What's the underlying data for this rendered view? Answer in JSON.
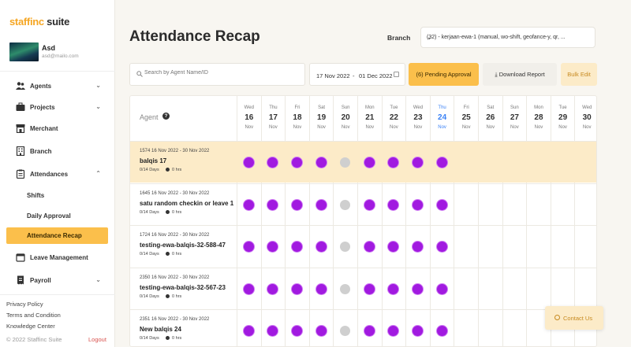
{
  "logo": {
    "brand": "staffinc",
    "suite": "suite"
  },
  "user": {
    "name": "Asd",
    "email": "asd@mailo.com"
  },
  "nav": {
    "agents": "Agents",
    "projects": "Projects",
    "merchant": "Merchant",
    "branch": "Branch",
    "attendances": "Attendances",
    "shifts": "Shifts",
    "daily_approval": "Daily Approval",
    "attendance_recap": "Attendance Recap",
    "leave_management": "Leave Management",
    "payroll": "Payroll"
  },
  "footer": {
    "privacy": "Privacy Policy",
    "terms": "Terms and Condition",
    "knowledge": "Knowledge Center",
    "copyright": "© 2022 Staffinc Suite",
    "logout": "Logout"
  },
  "page": {
    "title": "Attendance Recap",
    "branch_label": "Branch",
    "branch_value": "(32) - kerjaan-ewa-1 (manual, wo-shift, geofance-y, qr, ...",
    "search_placeholder": "Search by Agent Name/ID",
    "date_from": "17 Nov 2022",
    "date_sep": "-",
    "date_to": "01 Dec 2022",
    "pending_button": "(6) Pending Approval",
    "download_button": "Download Report",
    "bulk_button": "Bulk Edit",
    "contact_button": "Contact Us"
  },
  "table": {
    "agent_header": "Agent",
    "help_glyph": "?",
    "days": [
      {
        "dow": "Wed",
        "num": "16",
        "mon": "Nov"
      },
      {
        "dow": "Thu",
        "num": "17",
        "mon": "Nov"
      },
      {
        "dow": "Fri",
        "num": "18",
        "mon": "Nov"
      },
      {
        "dow": "Sat",
        "num": "19",
        "mon": "Nov"
      },
      {
        "dow": "Sun",
        "num": "20",
        "mon": "Nov"
      },
      {
        "dow": "Mon",
        "num": "21",
        "mon": "Nov"
      },
      {
        "dow": "Tue",
        "num": "22",
        "mon": "Nov"
      },
      {
        "dow": "Wed",
        "num": "23",
        "mon": "Nov"
      },
      {
        "dow": "Thu",
        "num": "24",
        "mon": "Nov",
        "today": true
      },
      {
        "dow": "Fri",
        "num": "25",
        "mon": "Nov"
      },
      {
        "dow": "Sat",
        "num": "26",
        "mon": "Nov"
      },
      {
        "dow": "Sun",
        "num": "27",
        "mon": "Nov"
      },
      {
        "dow": "Mon",
        "num": "28",
        "mon": "Nov"
      },
      {
        "dow": "Tue",
        "num": "29",
        "mon": "Nov"
      },
      {
        "dow": "Wed",
        "num": "30",
        "mon": "Nov"
      }
    ],
    "rows": [
      {
        "meta": "1574   16 Nov 2022 - 30 Nov 2022",
        "name": "balqis 17",
        "days": "0/14 Days",
        "hours": "0 hrs",
        "highlight": true,
        "status": [
          "p",
          "p",
          "p",
          "p",
          "g",
          "p",
          "p",
          "p",
          "p"
        ]
      },
      {
        "meta": "1645   16 Nov 2022 - 30 Nov 2022",
        "name": "satu random checkin or leave 1",
        "days": "0/14 Days",
        "hours": "0 hrs",
        "status": [
          "p",
          "p",
          "p",
          "p",
          "g",
          "p",
          "p",
          "p",
          "p"
        ]
      },
      {
        "meta": "1724   16 Nov 2022 - 30 Nov 2022",
        "name": "testing-ewa-balqis-32-588-47",
        "days": "0/14 Days",
        "hours": "0 hrs",
        "status": [
          "p",
          "p",
          "p",
          "p",
          "g",
          "p",
          "p",
          "p",
          "p"
        ]
      },
      {
        "meta": "2350   16 Nov 2022 - 30 Nov 2022",
        "name": "testing-ewa-balqis-32-567-23",
        "days": "0/14 Days",
        "hours": "0 hrs",
        "status": [
          "p",
          "p",
          "p",
          "p",
          "g",
          "p",
          "p",
          "p",
          "p"
        ]
      },
      {
        "meta": "2351   16 Nov 2022 - 30 Nov 2022",
        "name": "New balqis 24",
        "days": "0/14 Days",
        "hours": "0 hrs",
        "status": [
          "p",
          "p",
          "p",
          "p",
          "g",
          "p",
          "p",
          "p",
          "p"
        ]
      }
    ]
  },
  "colors": {
    "accent": "#fbbf4b",
    "present": "#a11ae0",
    "absent": "#cfcfcf",
    "today": "#3b82f6",
    "logout": "#d9534f"
  }
}
